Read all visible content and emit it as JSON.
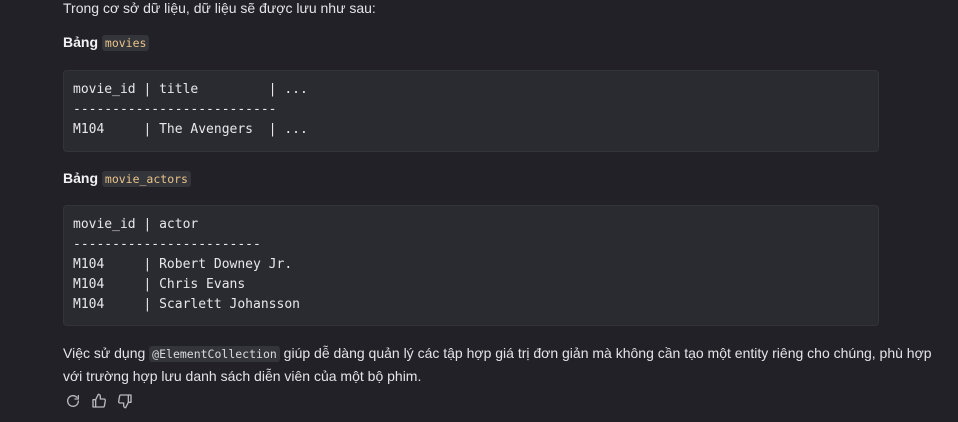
{
  "intro_text": "Trong cơ sở dữ liệu, dữ liệu sẽ được lưu như sau:",
  "table1": {
    "label": "Bảng",
    "name": "movies",
    "code_lines": [
      "movie_id | title         | ...",
      "--------------------------",
      "M104     | The Avengers  | ..."
    ]
  },
  "table2": {
    "label": "Bảng",
    "name": "movie_actors",
    "code_lines": [
      "movie_id | actor",
      "------------------------",
      "M104     | Robert Downey Jr.",
      "M104     | Chris Evans",
      "M104     | Scarlett Johansson"
    ]
  },
  "summary": {
    "before": "Việc sử dụng ",
    "code": "@ElementCollection",
    "after": " giúp dễ dàng quản lý các tập hợp giá trị đơn giản mà không cần tạo một entity riêng cho chúng, phù hợp",
    "line2": "với trường hợp lưu danh sách diễn viên của một bộ phim."
  },
  "actions": {
    "regenerate_icon": "refresh-icon",
    "like_icon": "thumbs-up-icon",
    "dislike_icon": "thumbs-down-icon"
  },
  "colors": {
    "background": "#212127",
    "code_background": "#2a2a31",
    "inline_code_text": "#e8c48a"
  }
}
